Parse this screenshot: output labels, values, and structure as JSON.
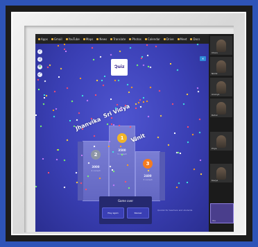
{
  "toolbar": {
    "items": [
      "Apps",
      "Gmail",
      "YouTube",
      "Maps",
      "News",
      "Translate",
      "Photos",
      "Calendar",
      "Drive",
      "Meet",
      "Docs"
    ]
  },
  "quiz": {
    "logo_text": "Quiz",
    "winners": [
      {
        "rank": "2",
        "name": "Jhanvika",
        "score": "3000",
        "sub": "4 correct",
        "badge_color": "#8d95a6"
      },
      {
        "rank": "1",
        "name": "Sri Vidya",
        "score": "3500",
        "sub": "5 correct",
        "badge_color": "#f0b429"
      },
      {
        "rank": "3",
        "name": "Vinit",
        "score": "2400",
        "sub": "3 correct",
        "badge_color": "#f47c20"
      }
    ],
    "dialog_title": "Game over",
    "dialog_buttons": [
      "Play again",
      "Review"
    ],
    "footer_text": "Quizizz for teachers and students"
  },
  "participants": [
    "Charu",
    "Nikhil",
    "Ananya",
    "Rahul",
    "Priya",
    "Kavya",
    "You"
  ]
}
